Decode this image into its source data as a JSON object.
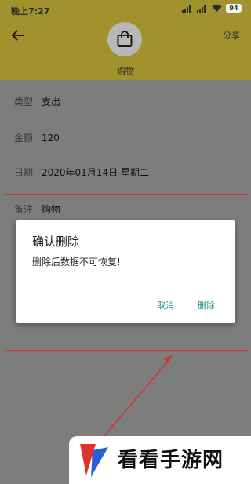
{
  "status_bar": {
    "time": "晚上7:27",
    "battery": "94"
  },
  "header": {
    "share_label": "分享",
    "category": "购物",
    "back_icon": "arrow-left-icon",
    "category_icon": "shopping-bag-icon"
  },
  "details": [
    {
      "key": "类型",
      "value": "支出"
    },
    {
      "key": "金额",
      "value": "120"
    },
    {
      "key": "日期",
      "value": "2020年01月14日 星期二"
    },
    {
      "key": "备注",
      "value": "购物"
    }
  ],
  "dialog": {
    "title": "确认删除",
    "message": "删除后数据不可恢复!",
    "cancel": "取消",
    "delete": "删除"
  },
  "colors": {
    "header": "#a1922d",
    "accent": "#20918f",
    "annotation": "#d9302b"
  },
  "watermark": {
    "text": "看看手游网"
  }
}
